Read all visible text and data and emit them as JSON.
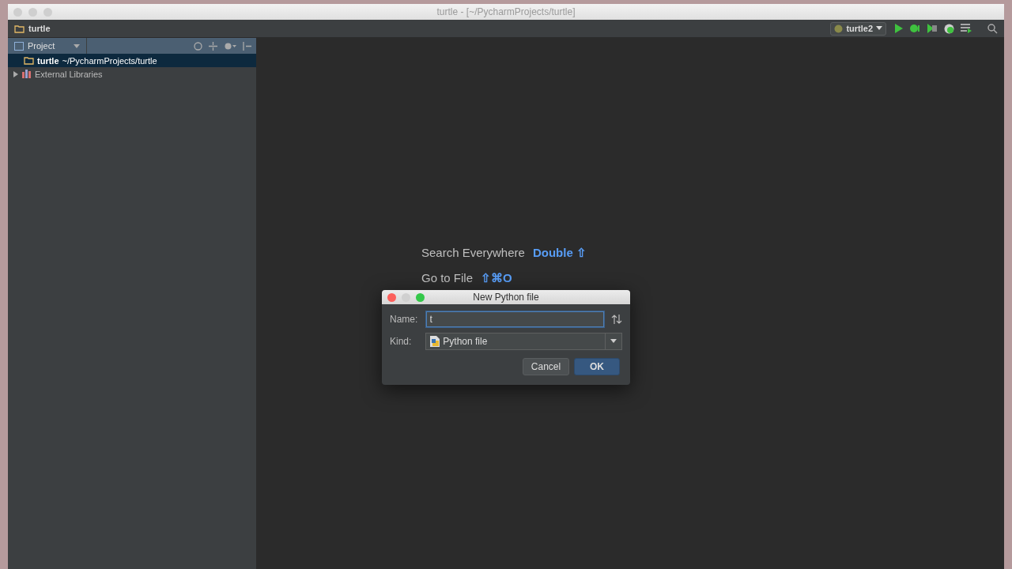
{
  "window": {
    "title": "turtle - [~/PycharmProjects/turtle]"
  },
  "navbar": {
    "crumb": "turtle",
    "run_config": "turtle2"
  },
  "project_panel": {
    "view": "Project",
    "tree": [
      {
        "kind": "folder",
        "name": "turtle",
        "path": "~/PycharmProjects/turtle",
        "selected": true
      },
      {
        "kind": "library",
        "name": "External Libraries",
        "selected": false,
        "expanded": false
      }
    ]
  },
  "editor_hints": [
    {
      "label": "Search Everywhere",
      "shortcut": "Double ⇧"
    },
    {
      "label": "Go to File",
      "shortcut": "⇧⌘O"
    }
  ],
  "dialog": {
    "title": "New Python file",
    "name_label": "Name:",
    "name_value": "t",
    "kind_label": "Kind:",
    "kind_value": "Python file",
    "buttons": [
      {
        "label": "Cancel",
        "default": false
      },
      {
        "label": "OK",
        "default": true
      }
    ]
  }
}
